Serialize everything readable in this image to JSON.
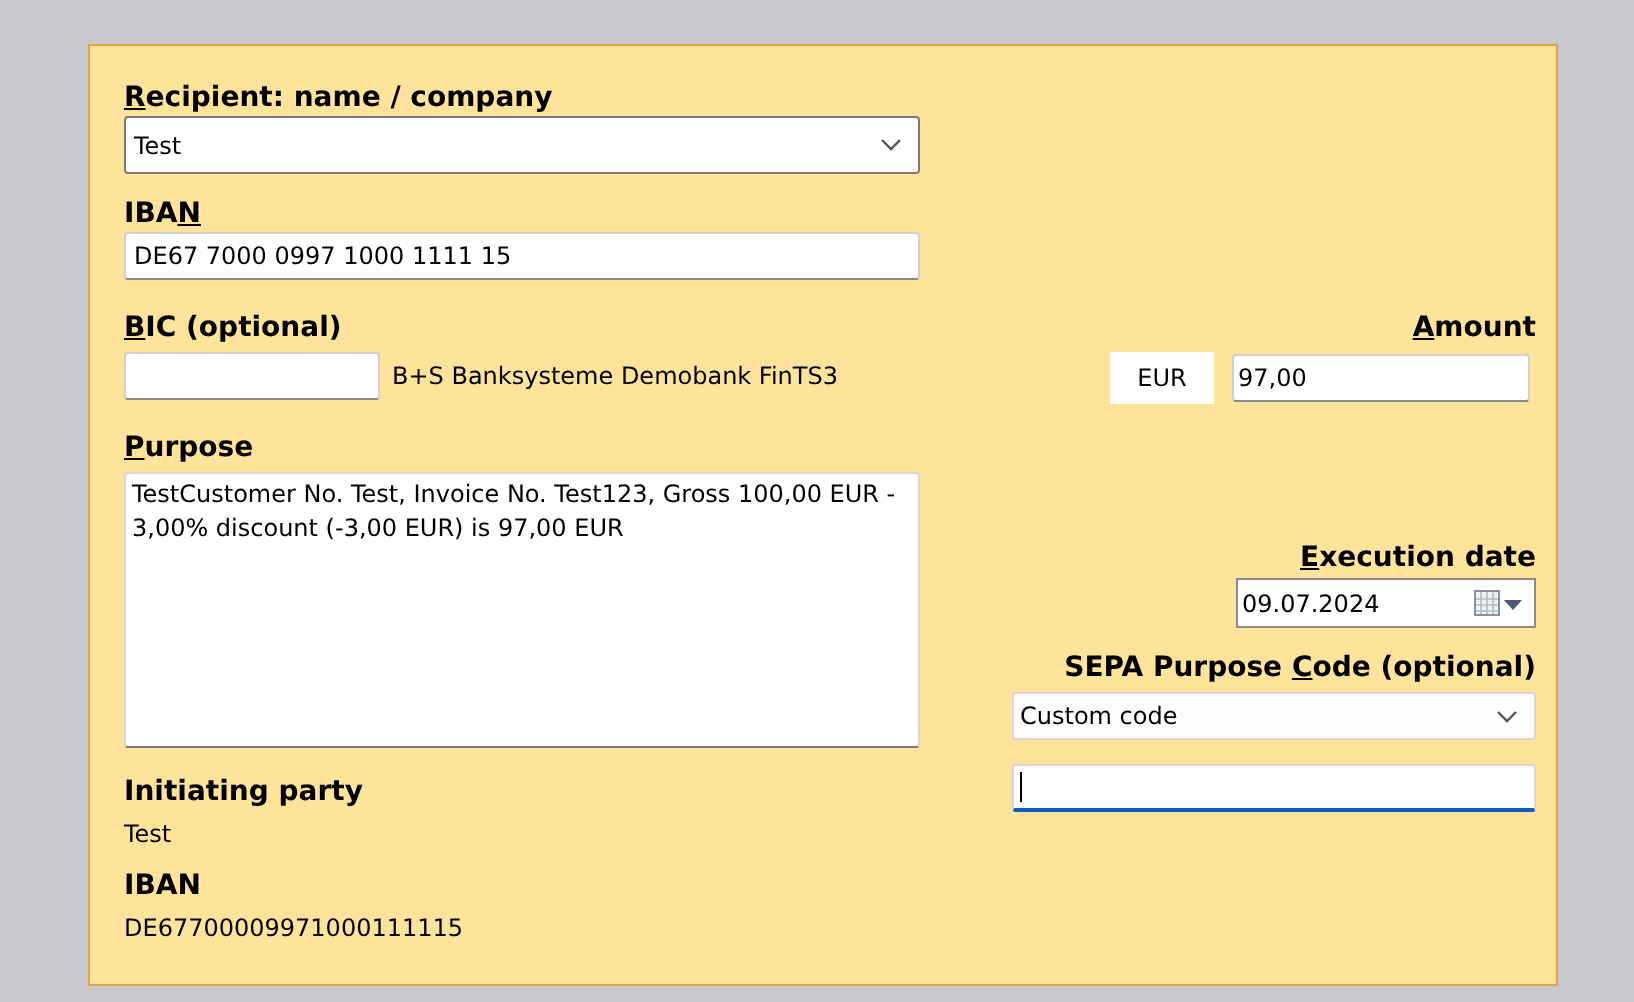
{
  "recipient": {
    "label": {
      "key": "R",
      "post": "ecipient: name / company"
    },
    "value": "Test"
  },
  "iban": {
    "label": {
      "pre": "IBA",
      "key": "N"
    },
    "value": "DE67 7000 0997 1000 1111 15"
  },
  "bic": {
    "label": {
      "key": "B",
      "post": "IC (optional)"
    },
    "bank_name": "B+S Banksysteme Demobank FinTS3"
  },
  "amount": {
    "label": {
      "key": "A",
      "post": "mount"
    },
    "currency": "EUR",
    "value": "97,00"
  },
  "purpose": {
    "label": {
      "key": "P",
      "post": "urpose"
    },
    "value": "TestCustomer No. Test, Invoice No. Test123, Gross 100,00 EUR - 3,00% discount (-3,00 EUR) is 97,00 EUR"
  },
  "execution_date": {
    "label": {
      "key": "E",
      "post": "xecution date"
    },
    "value": "09.07.2024"
  },
  "purpose_code": {
    "label": {
      "pre": "SEPA Purpose ",
      "key": "C",
      "post": "ode (optional)"
    },
    "value": "Custom code",
    "custom_field": {
      "focused": true
    }
  },
  "initiating_party": {
    "label": "Initiating party",
    "name": "Test",
    "iban_label": "IBAN",
    "iban": "DE67700009971000111115"
  }
}
